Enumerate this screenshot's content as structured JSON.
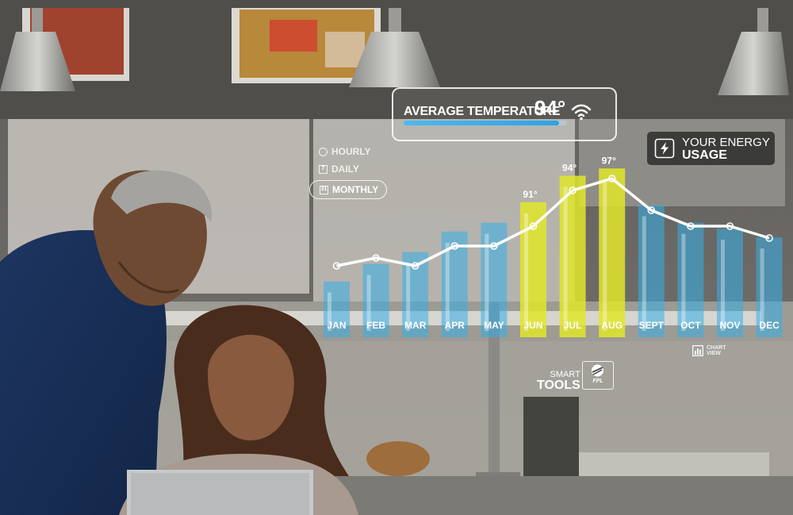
{
  "temperature": {
    "label": "AVERAGE TEMPERATURE",
    "value": "94°",
    "level": 0.95
  },
  "energy_badge": {
    "line1": "YOUR ENERGY",
    "line2": "USAGE"
  },
  "range_options": [
    {
      "label": "HOURLY",
      "icon": "clock-icon",
      "selected": false
    },
    {
      "label": "DAILY",
      "icon": "calendar-icon",
      "selected": false,
      "icon_text": "7"
    },
    {
      "label": "MONTHLY",
      "icon": "calendar-icon",
      "selected": true,
      "icon_text": "31"
    }
  ],
  "smart_tools": {
    "line1": "SMART",
    "line2": "TOOLS",
    "logo_text": "FPL"
  },
  "chart_view": {
    "label_line1": "CHART",
    "label_line2": "VIEW"
  },
  "chart_data": {
    "type": "bar",
    "categories": [
      "JAN",
      "FEB",
      "MAR",
      "APR",
      "MAY",
      "JUN",
      "JUL",
      "AUG",
      "SEPT",
      "OCT",
      "NOV",
      "DEC"
    ],
    "values": [
      38,
      50,
      58,
      72,
      78,
      92,
      110,
      115,
      90,
      78,
      74,
      68
    ],
    "line_values": [
      70,
      72,
      70,
      75,
      75,
      80,
      89,
      92,
      84,
      80,
      80,
      77
    ],
    "data_labels": {
      "5": "91°",
      "6": "94°",
      "7": "97°"
    },
    "highlight_indices": [
      5,
      6,
      7
    ],
    "colors": {
      "normal": "#35aee8",
      "highlight": "#e2e62a",
      "line": "#ffffff"
    },
    "ylim": [
      0,
      120
    ],
    "line_ylim": [
      60,
      100
    ]
  },
  "colors": {
    "accent_blue": "#35aee8",
    "accent_yellow": "#e2e62a"
  }
}
